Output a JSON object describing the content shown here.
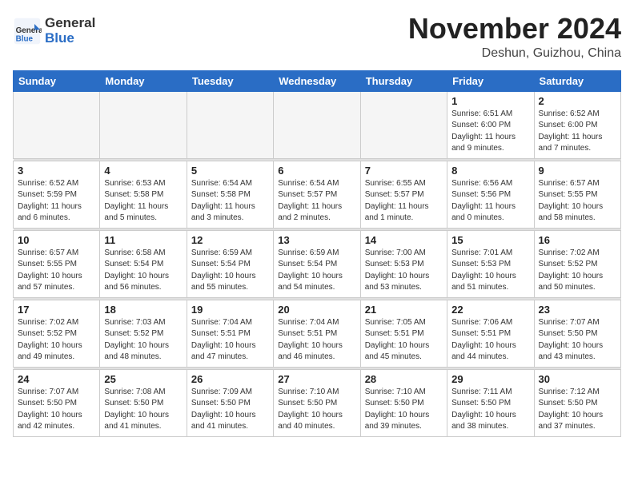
{
  "header": {
    "logo_general": "General",
    "logo_blue": "Blue",
    "month_title": "November 2024",
    "location": "Deshun, Guizhou, China"
  },
  "weekdays": [
    "Sunday",
    "Monday",
    "Tuesday",
    "Wednesday",
    "Thursday",
    "Friday",
    "Saturday"
  ],
  "weeks": [
    [
      {
        "day": "",
        "info": ""
      },
      {
        "day": "",
        "info": ""
      },
      {
        "day": "",
        "info": ""
      },
      {
        "day": "",
        "info": ""
      },
      {
        "day": "",
        "info": ""
      },
      {
        "day": "1",
        "info": "Sunrise: 6:51 AM\nSunset: 6:00 PM\nDaylight: 11 hours\nand 9 minutes."
      },
      {
        "day": "2",
        "info": "Sunrise: 6:52 AM\nSunset: 6:00 PM\nDaylight: 11 hours\nand 7 minutes."
      }
    ],
    [
      {
        "day": "3",
        "info": "Sunrise: 6:52 AM\nSunset: 5:59 PM\nDaylight: 11 hours\nand 6 minutes."
      },
      {
        "day": "4",
        "info": "Sunrise: 6:53 AM\nSunset: 5:58 PM\nDaylight: 11 hours\nand 5 minutes."
      },
      {
        "day": "5",
        "info": "Sunrise: 6:54 AM\nSunset: 5:58 PM\nDaylight: 11 hours\nand 3 minutes."
      },
      {
        "day": "6",
        "info": "Sunrise: 6:54 AM\nSunset: 5:57 PM\nDaylight: 11 hours\nand 2 minutes."
      },
      {
        "day": "7",
        "info": "Sunrise: 6:55 AM\nSunset: 5:57 PM\nDaylight: 11 hours\nand 1 minute."
      },
      {
        "day": "8",
        "info": "Sunrise: 6:56 AM\nSunset: 5:56 PM\nDaylight: 11 hours\nand 0 minutes."
      },
      {
        "day": "9",
        "info": "Sunrise: 6:57 AM\nSunset: 5:55 PM\nDaylight: 10 hours\nand 58 minutes."
      }
    ],
    [
      {
        "day": "10",
        "info": "Sunrise: 6:57 AM\nSunset: 5:55 PM\nDaylight: 10 hours\nand 57 minutes."
      },
      {
        "day": "11",
        "info": "Sunrise: 6:58 AM\nSunset: 5:54 PM\nDaylight: 10 hours\nand 56 minutes."
      },
      {
        "day": "12",
        "info": "Sunrise: 6:59 AM\nSunset: 5:54 PM\nDaylight: 10 hours\nand 55 minutes."
      },
      {
        "day": "13",
        "info": "Sunrise: 6:59 AM\nSunset: 5:54 PM\nDaylight: 10 hours\nand 54 minutes."
      },
      {
        "day": "14",
        "info": "Sunrise: 7:00 AM\nSunset: 5:53 PM\nDaylight: 10 hours\nand 53 minutes."
      },
      {
        "day": "15",
        "info": "Sunrise: 7:01 AM\nSunset: 5:53 PM\nDaylight: 10 hours\nand 51 minutes."
      },
      {
        "day": "16",
        "info": "Sunrise: 7:02 AM\nSunset: 5:52 PM\nDaylight: 10 hours\nand 50 minutes."
      }
    ],
    [
      {
        "day": "17",
        "info": "Sunrise: 7:02 AM\nSunset: 5:52 PM\nDaylight: 10 hours\nand 49 minutes."
      },
      {
        "day": "18",
        "info": "Sunrise: 7:03 AM\nSunset: 5:52 PM\nDaylight: 10 hours\nand 48 minutes."
      },
      {
        "day": "19",
        "info": "Sunrise: 7:04 AM\nSunset: 5:51 PM\nDaylight: 10 hours\nand 47 minutes."
      },
      {
        "day": "20",
        "info": "Sunrise: 7:04 AM\nSunset: 5:51 PM\nDaylight: 10 hours\nand 46 minutes."
      },
      {
        "day": "21",
        "info": "Sunrise: 7:05 AM\nSunset: 5:51 PM\nDaylight: 10 hours\nand 45 minutes."
      },
      {
        "day": "22",
        "info": "Sunrise: 7:06 AM\nSunset: 5:51 PM\nDaylight: 10 hours\nand 44 minutes."
      },
      {
        "day": "23",
        "info": "Sunrise: 7:07 AM\nSunset: 5:50 PM\nDaylight: 10 hours\nand 43 minutes."
      }
    ],
    [
      {
        "day": "24",
        "info": "Sunrise: 7:07 AM\nSunset: 5:50 PM\nDaylight: 10 hours\nand 42 minutes."
      },
      {
        "day": "25",
        "info": "Sunrise: 7:08 AM\nSunset: 5:50 PM\nDaylight: 10 hours\nand 41 minutes."
      },
      {
        "day": "26",
        "info": "Sunrise: 7:09 AM\nSunset: 5:50 PM\nDaylight: 10 hours\nand 41 minutes."
      },
      {
        "day": "27",
        "info": "Sunrise: 7:10 AM\nSunset: 5:50 PM\nDaylight: 10 hours\nand 40 minutes."
      },
      {
        "day": "28",
        "info": "Sunrise: 7:10 AM\nSunset: 5:50 PM\nDaylight: 10 hours\nand 39 minutes."
      },
      {
        "day": "29",
        "info": "Sunrise: 7:11 AM\nSunset: 5:50 PM\nDaylight: 10 hours\nand 38 minutes."
      },
      {
        "day": "30",
        "info": "Sunrise: 7:12 AM\nSunset: 5:50 PM\nDaylight: 10 hours\nand 37 minutes."
      }
    ]
  ]
}
